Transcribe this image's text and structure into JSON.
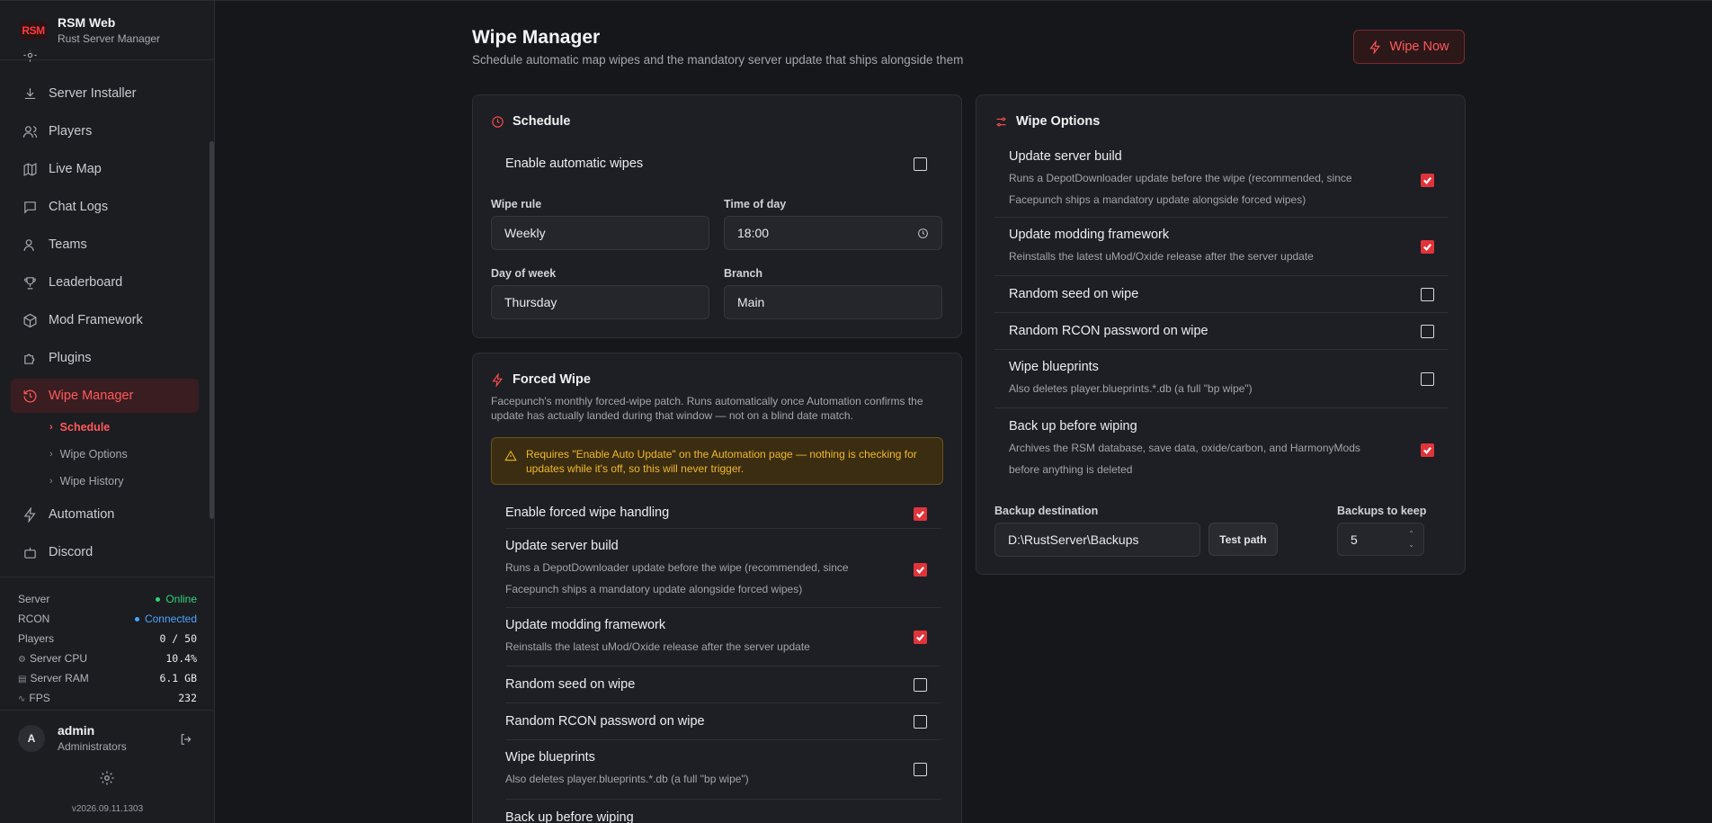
{
  "brand": {
    "logo": "RSM",
    "name": "RSM Web",
    "subtitle": "Rust Server Manager"
  },
  "nav": {
    "items": [
      {
        "label": "Server Installer",
        "icon": "download-icon"
      },
      {
        "label": "Players",
        "icon": "users-icon"
      },
      {
        "label": "Live Map",
        "icon": "map-icon"
      },
      {
        "label": "Chat Logs",
        "icon": "chat-icon"
      },
      {
        "label": "Teams",
        "icon": "team-icon"
      },
      {
        "label": "Leaderboard",
        "icon": "trophy-icon"
      },
      {
        "label": "Mod Framework",
        "icon": "cube-icon"
      },
      {
        "label": "Plugins",
        "icon": "puzzle-icon"
      },
      {
        "label": "Wipe Manager",
        "icon": "history-icon"
      },
      {
        "label": "Automation",
        "icon": "bolt-icon"
      },
      {
        "label": "Discord",
        "icon": "bot-icon"
      }
    ],
    "subitems": [
      {
        "label": "Schedule"
      },
      {
        "label": "Wipe Options"
      },
      {
        "label": "Wipe History"
      }
    ]
  },
  "status": {
    "server_label": "Server",
    "server_value": "Online",
    "rcon_label": "RCON",
    "rcon_value": "Connected",
    "players_label": "Players",
    "players_value": "0 / 50",
    "cpu_label": "Server CPU",
    "cpu_value": "10.4%",
    "ram_label": "Server RAM",
    "ram_value": "6.1 GB",
    "fps_label": "FPS",
    "fps_value": "232",
    "online_color": "#2ed47a",
    "rcon_color": "#4aa3ff"
  },
  "user": {
    "initial": "A",
    "name": "admin",
    "role": "Administrators"
  },
  "version": "v2026.09.11.1303",
  "page": {
    "title": "Wipe Manager",
    "subtitle": "Schedule automatic map wipes and the mandatory server update that ships alongside them",
    "wipe_now": "Wipe Now"
  },
  "schedule": {
    "title": "Schedule",
    "enable_label": "Enable automatic wipes",
    "enable_checked": false,
    "wipe_rule_label": "Wipe rule",
    "wipe_rule_value": "Weekly",
    "time_label": "Time of day",
    "time_value": "18:00",
    "day_label": "Day of week",
    "day_value": "Thursday",
    "branch_label": "Branch",
    "branch_value": "Main"
  },
  "forced": {
    "title": "Forced Wipe",
    "description": "Facepunch's monthly forced-wipe patch. Runs automatically once Automation confirms the update has actually landed during that window — not on a blind date match.",
    "warning": "Requires \"Enable Auto Update\" on the Automation page — nothing is checking for updates while it's off, so this will never trigger.",
    "options": [
      {
        "title": "Enable forced wipe handling",
        "desc": "",
        "checked": true
      },
      {
        "title": "Update server build",
        "desc": "Runs a DepotDownloader update before the wipe (recommended, since Facepunch ships a mandatory update alongside forced wipes)",
        "checked": true
      },
      {
        "title": "Update modding framework",
        "desc": "Reinstalls the latest uMod/Oxide release after the server update",
        "checked": true
      },
      {
        "title": "Random seed on wipe",
        "desc": "",
        "checked": false
      },
      {
        "title": "Random RCON password on wipe",
        "desc": "",
        "checked": false
      },
      {
        "title": "Wipe blueprints",
        "desc": "Also deletes player.blueprints.*.db (a full \"bp wipe\")",
        "checked": false
      },
      {
        "title": "Back up before wiping",
        "desc": "",
        "checked": true
      }
    ]
  },
  "wipe_options": {
    "title": "Wipe Options",
    "options": [
      {
        "title": "Update server build",
        "desc": "Runs a DepotDownloader update before the wipe (recommended, since Facepunch ships a mandatory update alongside forced wipes)",
        "checked": true
      },
      {
        "title": "Update modding framework",
        "desc": "Reinstalls the latest uMod/Oxide release after the server update",
        "checked": true
      },
      {
        "title": "Random seed on wipe",
        "desc": "",
        "checked": false
      },
      {
        "title": "Random RCON password on wipe",
        "desc": "",
        "checked": false
      },
      {
        "title": "Wipe blueprints",
        "desc": "Also deletes player.blueprints.*.db (a full \"bp wipe\")",
        "checked": false
      },
      {
        "title": "Back up before wiping",
        "desc": "Archives the RSM database, save data, oxide/carbon, and HarmonyMods before anything is deleted",
        "checked": true
      }
    ],
    "backup_dest_label": "Backup destination",
    "backup_dest_value": "D:\\RustServer\\Backups",
    "test_path": "Test path",
    "keep_label": "Backups to keep",
    "keep_value": "5"
  },
  "accent_color": "#e0343b"
}
